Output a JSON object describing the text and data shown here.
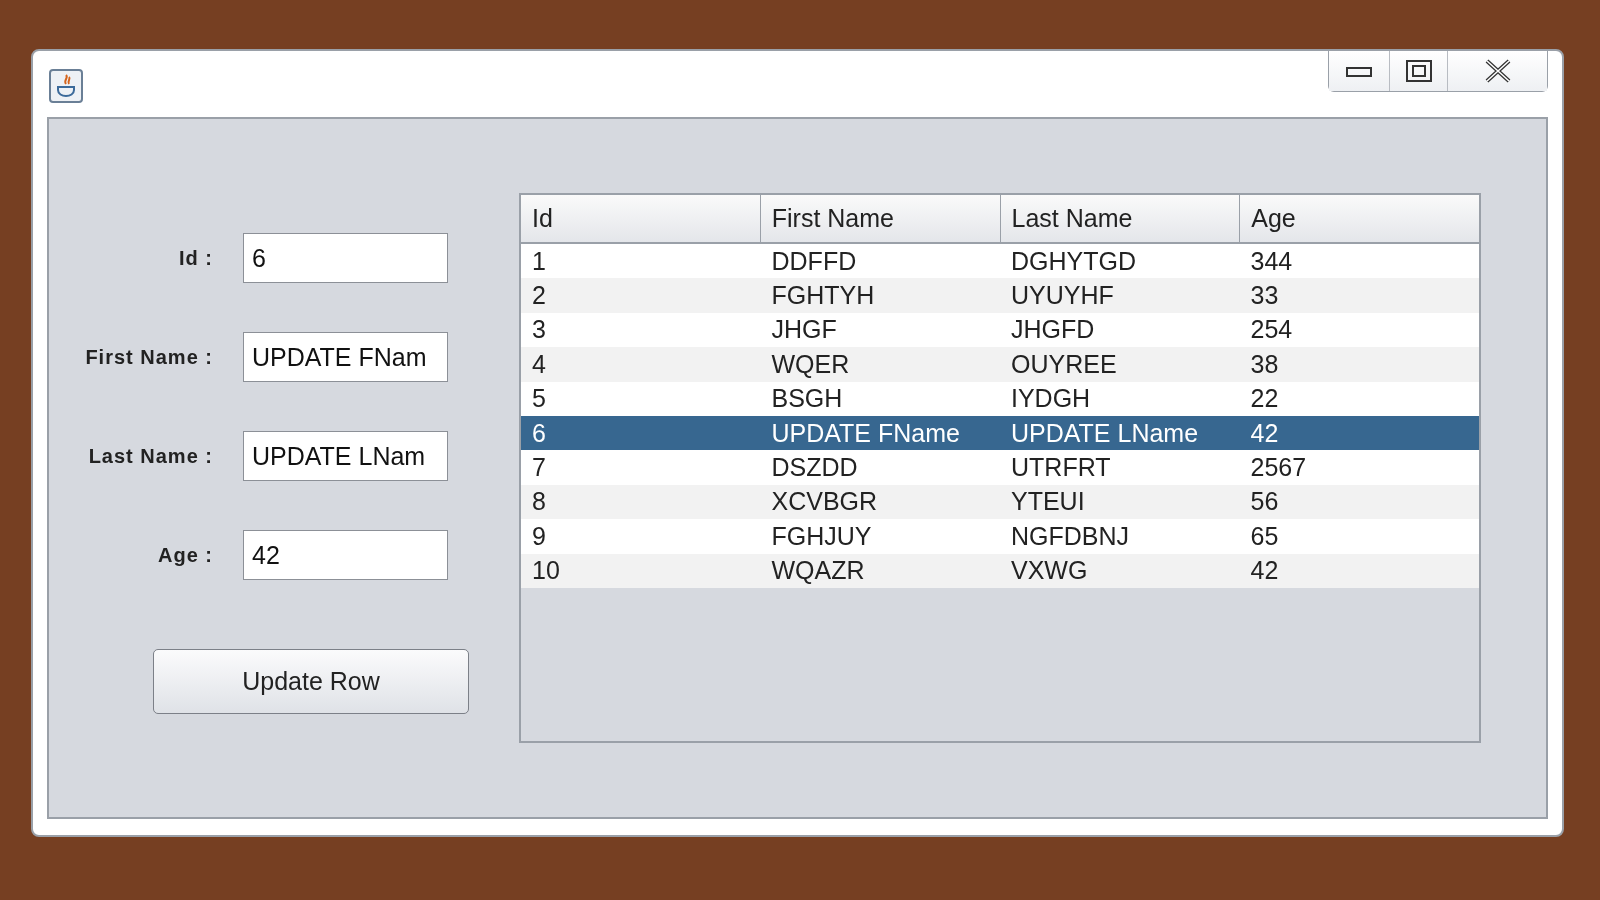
{
  "form": {
    "fields": [
      {
        "label": "Id :",
        "value": "6"
      },
      {
        "label": "First Name :",
        "value": "UPDATE FNam"
      },
      {
        "label": "Last Name :",
        "value": "UPDATE LNam"
      },
      {
        "label": "Age :",
        "value": "42"
      }
    ],
    "button": "Update Row"
  },
  "table": {
    "columns": [
      "Id",
      "First Name",
      "Last Name",
      "Age"
    ],
    "rows": [
      {
        "cells": [
          "1",
          "DDFFD",
          "DGHYTGD",
          "344"
        ],
        "selected": false
      },
      {
        "cells": [
          "2",
          "FGHTYH",
          "UYUYHF",
          "33"
        ],
        "selected": false
      },
      {
        "cells": [
          "3",
          "JHGF",
          "JHGFD",
          "254"
        ],
        "selected": false
      },
      {
        "cells": [
          "4",
          "WQER",
          "OUYREE",
          "38"
        ],
        "selected": false
      },
      {
        "cells": [
          "5",
          "BSGH",
          "IYDGH",
          "22"
        ],
        "selected": false
      },
      {
        "cells": [
          "6",
          "UPDATE FName",
          "UPDATE LName",
          "42"
        ],
        "selected": true
      },
      {
        "cells": [
          "7",
          "DSZDD",
          "UTRFRT",
          "2567"
        ],
        "selected": false
      },
      {
        "cells": [
          "8",
          "XCVBGR",
          "YTEUI",
          "56"
        ],
        "selected": false
      },
      {
        "cells": [
          "9",
          "FGHJUY",
          "NGFDBNJ",
          "65"
        ],
        "selected": false
      },
      {
        "cells": [
          "10",
          "WQAZR",
          "VXWG",
          "42"
        ],
        "selected": false
      }
    ]
  }
}
